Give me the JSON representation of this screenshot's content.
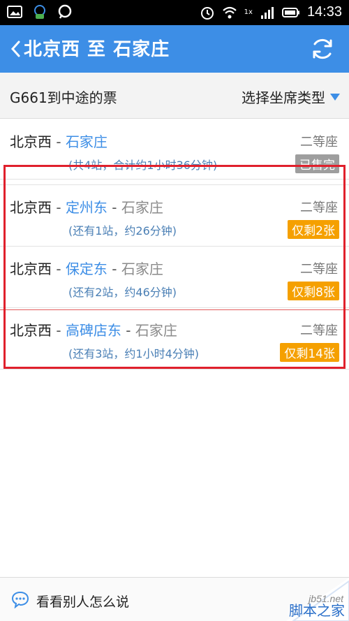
{
  "status_bar": {
    "time": "14:33",
    "network_label": "1x"
  },
  "header": {
    "title": "北京西 至 石家庄"
  },
  "subheader": {
    "title": "G661到中途的票",
    "seat_select": "选择坐席类型"
  },
  "rows": [
    {
      "from": "北京西",
      "sep1": " - ",
      "mid": "石家庄",
      "sep2": "",
      "to": "",
      "info": "(共4站，合计约1小时36分钟)",
      "seat": "二等座",
      "badge": "已售完"
    },
    {
      "from": "北京西",
      "sep1": " - ",
      "mid": "定州东",
      "sep2": " - ",
      "to": "石家庄",
      "info": "(还有1站，约26分钟)",
      "seat": "二等座",
      "badge": "仅剩2张"
    },
    {
      "from": "北京西",
      "sep1": " - ",
      "mid": "保定东",
      "sep2": " - ",
      "to": "石家庄",
      "info": "(还有2站，约46分钟)",
      "seat": "二等座",
      "badge": "仅剩8张"
    },
    {
      "from": "北京西",
      "sep1": " - ",
      "mid": "高碑店东",
      "sep2": " - ",
      "to": "石家庄",
      "info": "(还有3站，约1小时4分钟)",
      "seat": "二等座",
      "badge": "仅剩14张"
    }
  ],
  "colors": {
    "header_bg": "#3d8ee6",
    "sold_out": "#9e9e9e",
    "remaining": "#f5a000",
    "highlight": "#e0202c"
  },
  "bottom_bar": {
    "label": "看看别人怎么说"
  },
  "watermark": {
    "line1": "jb51.net",
    "line2": "脚本之家"
  }
}
